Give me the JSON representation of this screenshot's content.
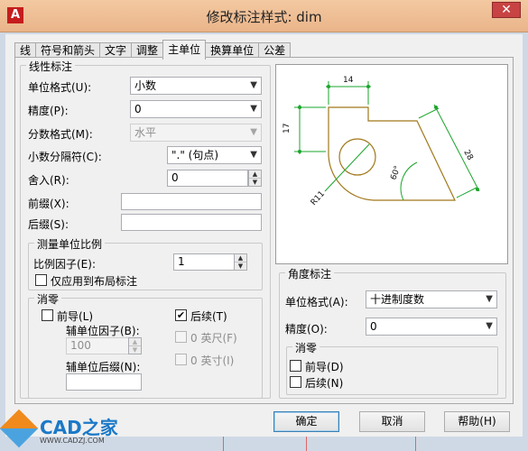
{
  "window": {
    "title": "修改标注样式: dim",
    "close": "✕",
    "app_icon": "A"
  },
  "tabs": [
    "线",
    "符号和箭头",
    "文字",
    "调整",
    "主单位",
    "换算单位",
    "公差"
  ],
  "active_tab": 4,
  "linear": {
    "group_title": "线性标注",
    "unit_format_label": "单位格式(U):",
    "unit_format_value": "小数",
    "precision_label": "精度(P):",
    "precision_value": "0",
    "fraction_format_label": "分数格式(M):",
    "fraction_format_value": "水平",
    "decimal_sep_label": "小数分隔符(C):",
    "decimal_sep_value": "\".\"  (句点)",
    "round_label": "舍入(R):",
    "round_value": "0",
    "prefix_label": "前缀(X):",
    "prefix_value": "",
    "suffix_label": "后缀(S):",
    "suffix_value": ""
  },
  "scale": {
    "group_title": "测量单位比例",
    "factor_label": "比例因子(E):",
    "factor_value": "1",
    "layout_only_label": "仅应用到布局标注",
    "layout_only_checked": false
  },
  "zero_suppress": {
    "group_title": "消零",
    "leading_label": "前导(L)",
    "leading_checked": false,
    "trailing_label": "后续(T)",
    "trailing_checked": true,
    "sub_factor_label": "辅单位因子(B):",
    "sub_factor_value": "100",
    "sub_suffix_label": "辅单位后缀(N):",
    "sub_suffix_value": "",
    "feet_label": "0 英尺(F)",
    "inches_label": "0 英寸(I)"
  },
  "angular": {
    "group_title": "角度标注",
    "unit_format_label": "单位格式(A):",
    "unit_format_value": "十进制度数",
    "precision_label": "精度(O):",
    "precision_value": "0",
    "zero_group_title": "消零",
    "leading_label": "前导(D)",
    "trailing_label": "后续(N)"
  },
  "preview": {
    "dim_top": "14",
    "dim_left": "17",
    "dim_right": "28",
    "dim_angle": "60°",
    "dim_radius": "R11"
  },
  "buttons": {
    "ok": "确定",
    "cancel": "取消",
    "help": "帮助(H)"
  },
  "watermark": {
    "brand": "CAD之家",
    "url": "WWW.CADZJ.COM"
  },
  "colors": {
    "titlebar": "#eab489",
    "preview_shape": "#a0781a",
    "dim_lines": "#1aa52b"
  }
}
